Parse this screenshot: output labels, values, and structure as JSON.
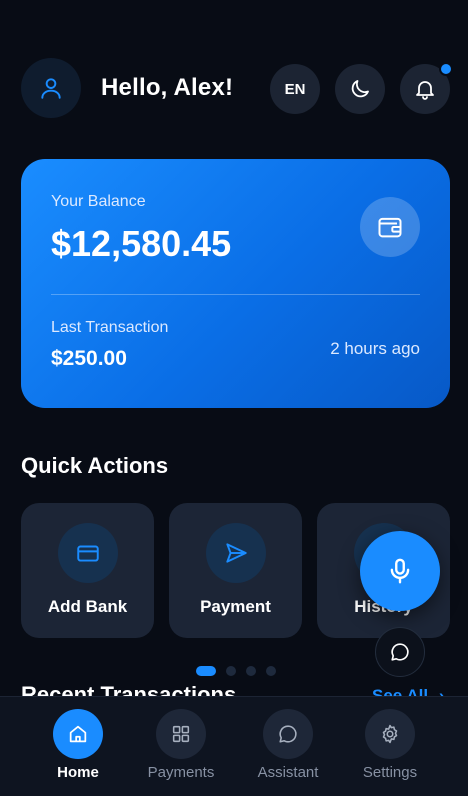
{
  "header": {
    "greeting": "Hello, Alex!",
    "language": "EN",
    "icons": {
      "avatar": "user-icon",
      "theme": "moon-icon",
      "notifications": "bell-icon"
    },
    "has_notification": true
  },
  "balance_card": {
    "label": "Your Balance",
    "amount": "$12,580.45",
    "icon": "wallet-icon",
    "last_transaction_label": "Last Transaction",
    "last_transaction_amount": "$250.00",
    "last_transaction_time": "2 hours ago"
  },
  "quick_actions": {
    "title": "Quick Actions",
    "items": [
      {
        "label": "Add Bank",
        "icon": "credit-card-icon"
      },
      {
        "label": "Payment",
        "icon": "send-icon"
      },
      {
        "label": "History",
        "icon": "history-icon"
      }
    ]
  },
  "carousel": {
    "pages": 4,
    "active": 0
  },
  "recent": {
    "title": "Recent Transactions",
    "see_all": "See All"
  },
  "fabs": {
    "mic": "microphone-icon",
    "chat": "chat-bubble-icon"
  },
  "bottom_nav": {
    "items": [
      {
        "label": "Home",
        "icon": "home-icon",
        "active": true
      },
      {
        "label": "Payments",
        "icon": "grid-icon",
        "active": false
      },
      {
        "label": "Assistant",
        "icon": "chat-bubble-icon",
        "active": false
      },
      {
        "label": "Settings",
        "icon": "gear-icon",
        "active": false
      }
    ]
  },
  "colors": {
    "background": "#080c15",
    "accent": "#1a8cff",
    "card_surface": "#1c2536",
    "muted_text": "#8791a3"
  }
}
